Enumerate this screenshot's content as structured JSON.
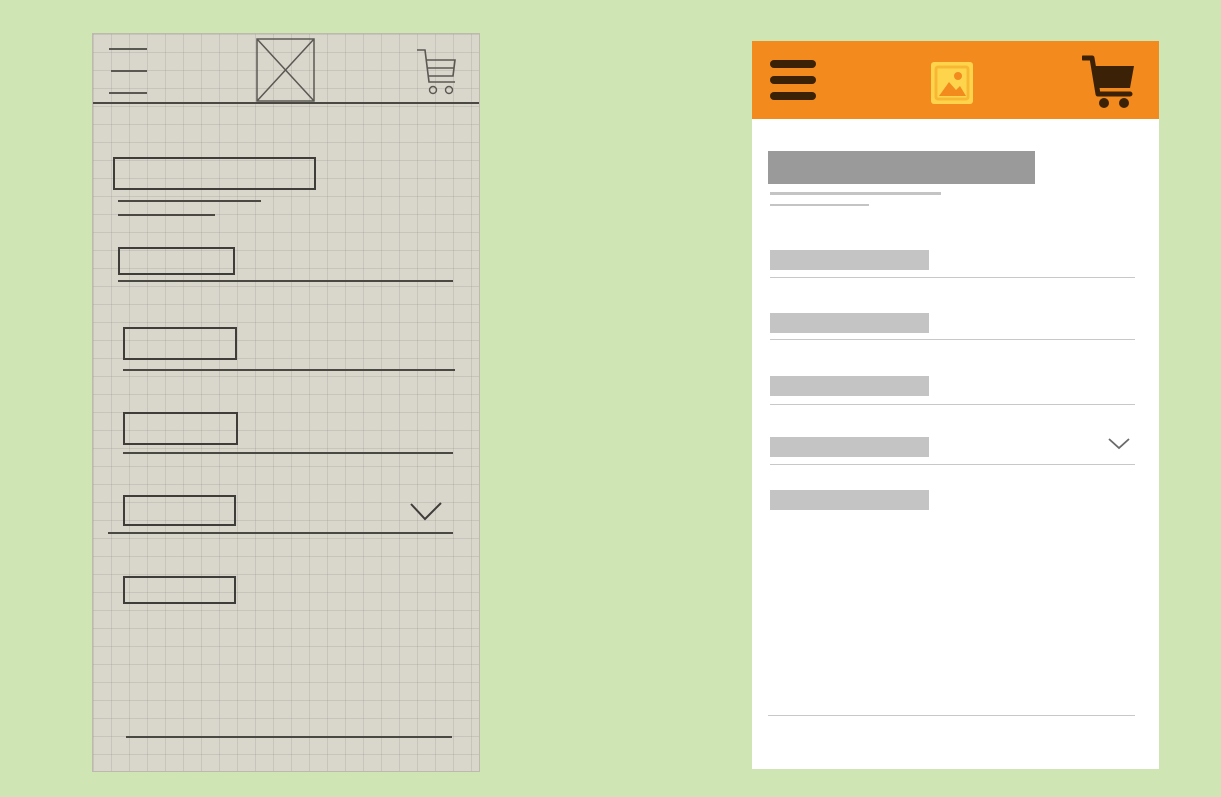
{
  "colors": {
    "background": "#cfe5b4",
    "header_orange": "#f28a1e",
    "icon_dark": "#3b2207",
    "logo_fill": "#ffd44d",
    "placeholder_dark": "#9a9a9a",
    "placeholder_light": "#c4c4c4",
    "divider": "#c8c8c8",
    "chevron": "#6a6a6a"
  },
  "sketch": {
    "header_icons": [
      "hamburger-icon",
      "image-placeholder-icon",
      "cart-icon"
    ],
    "list_rows": 5,
    "dropdown_row_index": 3
  },
  "mockup": {
    "header_icons": [
      "hamburger-icon",
      "image-icon",
      "cart-icon"
    ],
    "list_rows": 5,
    "dropdown_row_index": 3
  }
}
